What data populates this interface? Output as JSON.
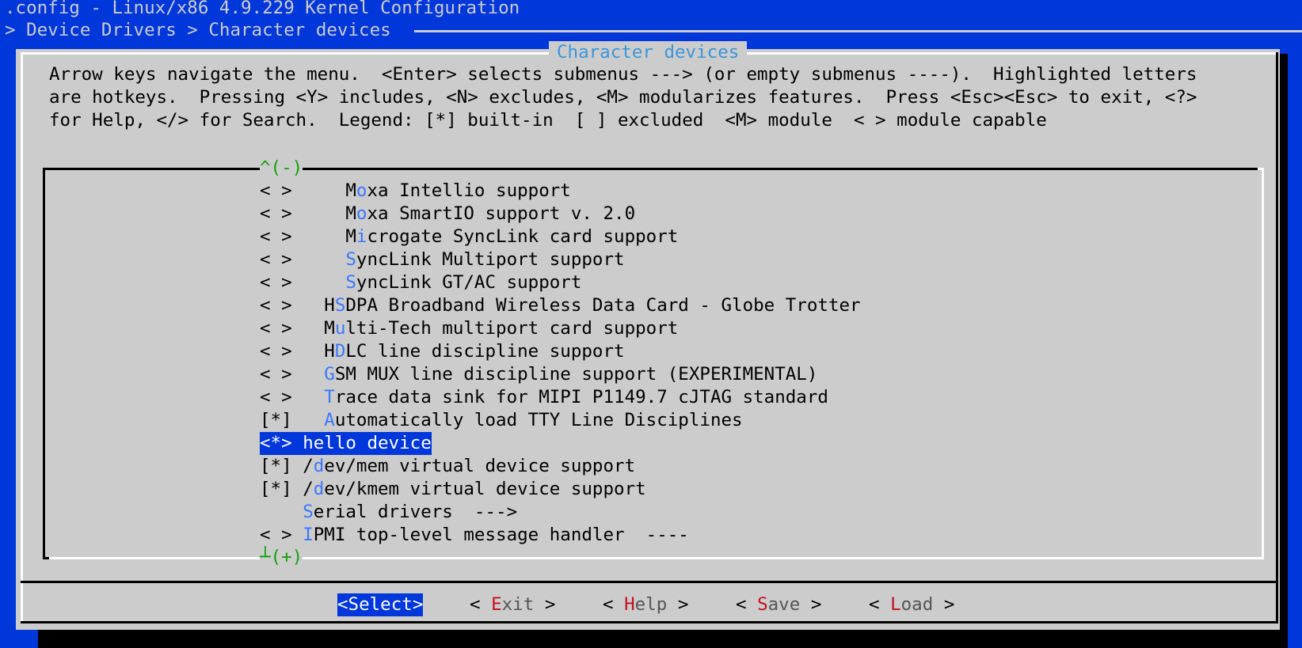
{
  "header": {
    "title": ".config - Linux/x86 4.9.229 Kernel Configuration",
    "breadcrumb": "> Device Drivers > Character devices"
  },
  "dialog": {
    "title": "Character devices",
    "help_lines": [
      "Arrow keys navigate the menu.  <Enter> selects submenus ---> (or empty submenus ----).  Highlighted letters",
      "are hotkeys.  Pressing <Y> includes, <N> excludes, <M> modularizes features.  Press <Esc><Esc> to exit, <?>",
      "for Help, </> for Search.  Legend: [*] built-in  [ ] excluded  <M> module  < > module capable"
    ],
    "scroll_up": "^(-)",
    "scroll_down": "┴(+)"
  },
  "menu": {
    "items": [
      {
        "prefix": "< >     ",
        "prehk": "M",
        "hk": "o",
        "rest": "xa Intellio support"
      },
      {
        "prefix": "< >     ",
        "prehk": "M",
        "hk": "o",
        "rest": "xa SmartIO support v. 2.0"
      },
      {
        "prefix": "< >     ",
        "prehk": "M",
        "hk": "i",
        "rest": "crogate SyncLink card support"
      },
      {
        "prefix": "< >     ",
        "prehk": "",
        "hk": "S",
        "rest": "yncLink Multiport support"
      },
      {
        "prefix": "< >     ",
        "prehk": "",
        "hk": "S",
        "rest": "yncLink GT/AC support"
      },
      {
        "prefix": "< >   ",
        "prehk": "H",
        "hk": "S",
        "rest": "DPA Broadband Wireless Data Card - Globe Trotter"
      },
      {
        "prefix": "< >   ",
        "prehk": "M",
        "hk": "u",
        "rest": "lti-Tech multiport card support"
      },
      {
        "prefix": "< >   ",
        "prehk": "H",
        "hk": "D",
        "rest": "LC line discipline support"
      },
      {
        "prefix": "< >   ",
        "prehk": "",
        "hk": "G",
        "rest": "SM MUX line discipline support (EXPERIMENTAL)"
      },
      {
        "prefix": "< >   ",
        "prehk": "",
        "hk": "T",
        "rest": "race data sink for MIPI P1149.7 cJTAG standard"
      },
      {
        "prefix": "[*]   ",
        "prehk": "",
        "hk": "A",
        "rest": "utomatically load TTY Line Disciplines"
      },
      {
        "prefix": "<*> ",
        "prehk": "",
        "hk": "",
        "rest": "hello device"
      },
      {
        "prefix": "[*] ",
        "prehk": "/",
        "hk": "d",
        "rest": "ev/mem virtual device support"
      },
      {
        "prefix": "[*] ",
        "prehk": "/",
        "hk": "d",
        "rest": "ev/kmem virtual device support"
      },
      {
        "prefix": "    ",
        "prehk": "",
        "hk": "S",
        "rest": "erial drivers  --->"
      },
      {
        "prefix": "< > ",
        "prehk": "",
        "hk": "I",
        "rest": "PMI top-level message handler  ----"
      }
    ]
  },
  "buttons": [
    {
      "open": "<",
      "key": "S",
      "rest": "elect",
      "close": ">",
      "selected": true
    },
    {
      "open": "< ",
      "key": "E",
      "rest": "xit",
      "close": " >",
      "selected": false
    },
    {
      "open": "< ",
      "key": "H",
      "rest": "elp",
      "close": " >",
      "selected": false
    },
    {
      "open": "< ",
      "key": "S",
      "rest": "ave",
      "close": " >",
      "selected": false
    },
    {
      "open": "< ",
      "key": "L",
      "rest": "oad",
      "close": " >",
      "selected": false
    }
  ],
  "colors": {
    "background": "#0037da",
    "dialog": "#cccccc",
    "hotkey": "#3b78ff",
    "button_hotkey": "#c50f1f",
    "scroll_arrow": "#13a10e",
    "title_text": "#3a96dd"
  }
}
